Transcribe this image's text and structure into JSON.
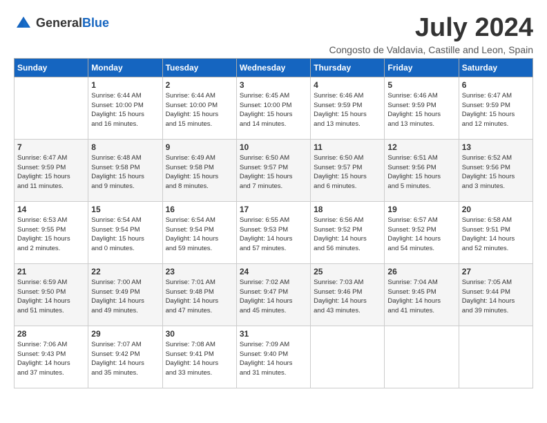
{
  "header": {
    "logo_general": "General",
    "logo_blue": "Blue",
    "month_title": "July 2024",
    "location": "Congosto de Valdavia, Castille and Leon, Spain"
  },
  "days_of_week": [
    "Sunday",
    "Monday",
    "Tuesday",
    "Wednesday",
    "Thursday",
    "Friday",
    "Saturday"
  ],
  "weeks": [
    [
      {
        "day": "",
        "info": ""
      },
      {
        "day": "1",
        "info": "Sunrise: 6:44 AM\nSunset: 10:00 PM\nDaylight: 15 hours\nand 16 minutes."
      },
      {
        "day": "2",
        "info": "Sunrise: 6:44 AM\nSunset: 10:00 PM\nDaylight: 15 hours\nand 15 minutes."
      },
      {
        "day": "3",
        "info": "Sunrise: 6:45 AM\nSunset: 10:00 PM\nDaylight: 15 hours\nand 14 minutes."
      },
      {
        "day": "4",
        "info": "Sunrise: 6:46 AM\nSunset: 9:59 PM\nDaylight: 15 hours\nand 13 minutes."
      },
      {
        "day": "5",
        "info": "Sunrise: 6:46 AM\nSunset: 9:59 PM\nDaylight: 15 hours\nand 13 minutes."
      },
      {
        "day": "6",
        "info": "Sunrise: 6:47 AM\nSunset: 9:59 PM\nDaylight: 15 hours\nand 12 minutes."
      }
    ],
    [
      {
        "day": "7",
        "info": "Sunrise: 6:47 AM\nSunset: 9:59 PM\nDaylight: 15 hours\nand 11 minutes."
      },
      {
        "day": "8",
        "info": "Sunrise: 6:48 AM\nSunset: 9:58 PM\nDaylight: 15 hours\nand 9 minutes."
      },
      {
        "day": "9",
        "info": "Sunrise: 6:49 AM\nSunset: 9:58 PM\nDaylight: 15 hours\nand 8 minutes."
      },
      {
        "day": "10",
        "info": "Sunrise: 6:50 AM\nSunset: 9:57 PM\nDaylight: 15 hours\nand 7 minutes."
      },
      {
        "day": "11",
        "info": "Sunrise: 6:50 AM\nSunset: 9:57 PM\nDaylight: 15 hours\nand 6 minutes."
      },
      {
        "day": "12",
        "info": "Sunrise: 6:51 AM\nSunset: 9:56 PM\nDaylight: 15 hours\nand 5 minutes."
      },
      {
        "day": "13",
        "info": "Sunrise: 6:52 AM\nSunset: 9:56 PM\nDaylight: 15 hours\nand 3 minutes."
      }
    ],
    [
      {
        "day": "14",
        "info": "Sunrise: 6:53 AM\nSunset: 9:55 PM\nDaylight: 15 hours\nand 2 minutes."
      },
      {
        "day": "15",
        "info": "Sunrise: 6:54 AM\nSunset: 9:54 PM\nDaylight: 15 hours\nand 0 minutes."
      },
      {
        "day": "16",
        "info": "Sunrise: 6:54 AM\nSunset: 9:54 PM\nDaylight: 14 hours\nand 59 minutes."
      },
      {
        "day": "17",
        "info": "Sunrise: 6:55 AM\nSunset: 9:53 PM\nDaylight: 14 hours\nand 57 minutes."
      },
      {
        "day": "18",
        "info": "Sunrise: 6:56 AM\nSunset: 9:52 PM\nDaylight: 14 hours\nand 56 minutes."
      },
      {
        "day": "19",
        "info": "Sunrise: 6:57 AM\nSunset: 9:52 PM\nDaylight: 14 hours\nand 54 minutes."
      },
      {
        "day": "20",
        "info": "Sunrise: 6:58 AM\nSunset: 9:51 PM\nDaylight: 14 hours\nand 52 minutes."
      }
    ],
    [
      {
        "day": "21",
        "info": "Sunrise: 6:59 AM\nSunset: 9:50 PM\nDaylight: 14 hours\nand 51 minutes."
      },
      {
        "day": "22",
        "info": "Sunrise: 7:00 AM\nSunset: 9:49 PM\nDaylight: 14 hours\nand 49 minutes."
      },
      {
        "day": "23",
        "info": "Sunrise: 7:01 AM\nSunset: 9:48 PM\nDaylight: 14 hours\nand 47 minutes."
      },
      {
        "day": "24",
        "info": "Sunrise: 7:02 AM\nSunset: 9:47 PM\nDaylight: 14 hours\nand 45 minutes."
      },
      {
        "day": "25",
        "info": "Sunrise: 7:03 AM\nSunset: 9:46 PM\nDaylight: 14 hours\nand 43 minutes."
      },
      {
        "day": "26",
        "info": "Sunrise: 7:04 AM\nSunset: 9:45 PM\nDaylight: 14 hours\nand 41 minutes."
      },
      {
        "day": "27",
        "info": "Sunrise: 7:05 AM\nSunset: 9:44 PM\nDaylight: 14 hours\nand 39 minutes."
      }
    ],
    [
      {
        "day": "28",
        "info": "Sunrise: 7:06 AM\nSunset: 9:43 PM\nDaylight: 14 hours\nand 37 minutes."
      },
      {
        "day": "29",
        "info": "Sunrise: 7:07 AM\nSunset: 9:42 PM\nDaylight: 14 hours\nand 35 minutes."
      },
      {
        "day": "30",
        "info": "Sunrise: 7:08 AM\nSunset: 9:41 PM\nDaylight: 14 hours\nand 33 minutes."
      },
      {
        "day": "31",
        "info": "Sunrise: 7:09 AM\nSunset: 9:40 PM\nDaylight: 14 hours\nand 31 minutes."
      },
      {
        "day": "",
        "info": ""
      },
      {
        "day": "",
        "info": ""
      },
      {
        "day": "",
        "info": ""
      }
    ]
  ]
}
